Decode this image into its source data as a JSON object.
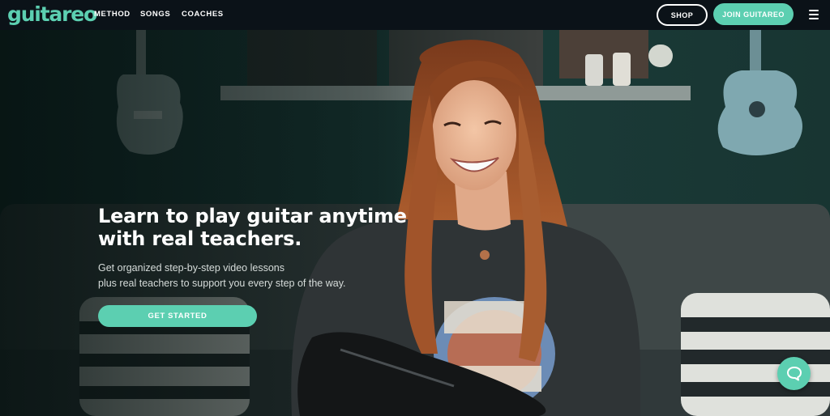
{
  "brand": {
    "logo_text": "guitareo",
    "accent_color": "#5ccfb1",
    "nav_bg": "#0b1218"
  },
  "nav": {
    "links": [
      {
        "label": "METHOD"
      },
      {
        "label": "SONGS"
      },
      {
        "label": "COACHES"
      }
    ],
    "shop_label": "SHOP",
    "join_label": "JOIN GUITAREO",
    "menu_icon": "hamburger-icon"
  },
  "hero": {
    "headline_line1": "Learn to play guitar anytime",
    "headline_line2": "with real teachers.",
    "subline_line1": "Get organized step-by-step video lessons",
    "subline_line2": "plus real teachers to support you every step of the way.",
    "cta_label": "GET STARTED",
    "image": "smiling-guitarist-photo"
  },
  "chat": {
    "icon": "chat-bubble-icon"
  }
}
